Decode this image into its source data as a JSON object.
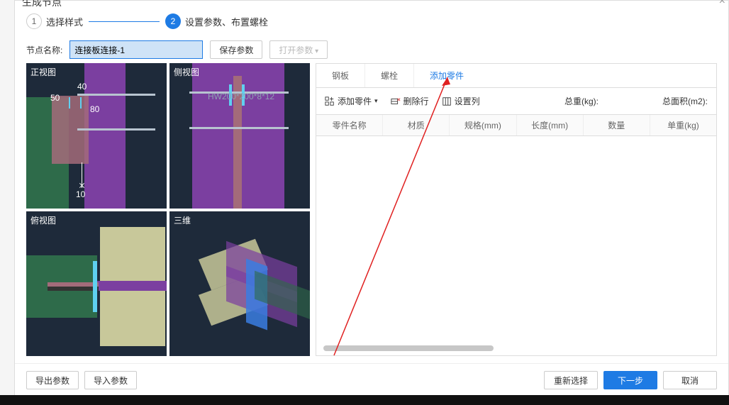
{
  "dialog": {
    "title": "生成节点",
    "close_icon": "×"
  },
  "steps": {
    "step1": {
      "num": "1",
      "label": "选择样式"
    },
    "step2": {
      "num": "2",
      "label": "设置参数、布置螺栓"
    }
  },
  "name_row": {
    "label": "节点名称:",
    "value": "连接板连接-1",
    "save_params": "保存参数",
    "open_params": "打开参数"
  },
  "views": {
    "front": "正视图",
    "side": "侧视图",
    "top": "俯视图",
    "three_d": "三维",
    "dims": {
      "d40": "40",
      "d50": "50",
      "d80": "80",
      "d10": "10"
    },
    "side_beam": "HW200*200*8*12"
  },
  "tabs": {
    "plate": "钢板",
    "bolt": "螺栓",
    "add_part": "添加零件"
  },
  "toolbar": {
    "add_part": "添加零件",
    "delete_row": "删除行",
    "set_columns": "设置列"
  },
  "stats": {
    "total_weight": "总重(kg):",
    "total_area": "总面积(m2):"
  },
  "columns": {
    "part_name": "零件名称",
    "material": "材质",
    "spec": "规格(mm)",
    "length": "长度(mm)",
    "qty": "数量",
    "unit_weight": "单重(kg)"
  },
  "footer": {
    "export_params": "导出参数",
    "import_params": "导入参数",
    "reselect": "重新选择",
    "next": "下一步",
    "cancel": "取消"
  }
}
